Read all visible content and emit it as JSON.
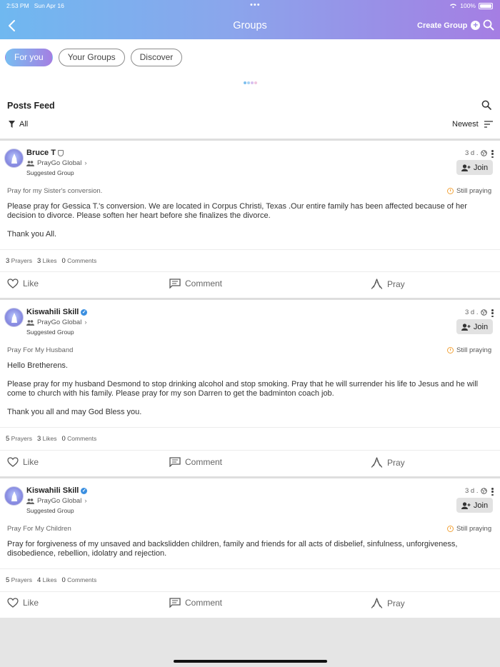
{
  "status_bar": {
    "time": "2:53 PM",
    "date": "Sun Apr 16",
    "battery": "100%"
  },
  "header": {
    "title": "Groups",
    "create_group_label": "Create Group"
  },
  "tabs": [
    {
      "label": "For you",
      "active": true
    },
    {
      "label": "Your Groups",
      "active": false
    },
    {
      "label": "Discover",
      "active": false
    }
  ],
  "feed": {
    "title": "Posts Feed",
    "filter_label": "All",
    "sort_label": "Newest"
  },
  "posts": [
    {
      "author": "Bruce T",
      "badge": "shield-icon",
      "group": "PrayGo Global",
      "suggested": "Suggested Group",
      "time": "3 d .",
      "join_label": "Join",
      "prayer_title": "Pray for my Sister's conversion.",
      "status": "Still praying",
      "body": [
        "Please pray for Gessica T.'s conversion. We are located in Corpus Christi, Texas .Our entire family has been affected because of her decision to divorce. Please soften her heart before she finalizes the divorce.",
        "Thank you All."
      ],
      "prayers_count": "3",
      "prayers_label": "Prayers",
      "likes_count": "3",
      "likes_label": "Likes",
      "comments_count": "0",
      "comments_label": "Comments",
      "like_label": "Like",
      "comment_label": "Comment",
      "pray_label": "Pray"
    },
    {
      "author": "Kiswahili Skill",
      "badge": "verified-icon",
      "group": "PrayGo Global",
      "suggested": "Suggested Group",
      "time": "3 d .",
      "join_label": "Join",
      "prayer_title": "Pray For My Husband",
      "status": "Still praying",
      "body": [
        "Hello Bretherens.",
        "Please pray for my husband Desmond to stop drinking alcohol and stop smoking. Pray that he will surrender his life to Jesus and he will come to church with his family. Please pray for my son Darren to get the badminton coach job.",
        "Thank you all and may God Bless you."
      ],
      "prayers_count": "5",
      "prayers_label": "Prayers",
      "likes_count": "3",
      "likes_label": "Likes",
      "comments_count": "0",
      "comments_label": "Comments",
      "like_label": "Like",
      "comment_label": "Comment",
      "pray_label": "Pray"
    },
    {
      "author": "Kiswahili Skill",
      "badge": "verified-icon",
      "group": "PrayGo Global",
      "suggested": "Suggested Group",
      "time": "3 d .",
      "join_label": "Join",
      "prayer_title": "Pray For My Children",
      "status": "Still praying",
      "body": [
        "Pray for forgiveness of my unsaved and backslidden children, family and friends for all acts of disbelief, sinfulness, unforgiveness, disobedience, rebellion, idolatry and rejection."
      ],
      "prayers_count": "5",
      "prayers_label": "Prayers",
      "likes_count": "4",
      "likes_label": "Likes",
      "comments_count": "0",
      "comments_label": "Comments",
      "like_label": "Like",
      "comment_label": "Comment",
      "pray_label": "Pray"
    }
  ],
  "colors": {
    "accent_start": "#6fb8f0",
    "accent_end": "#a57ee3",
    "verified": "#3a8fe0",
    "praying": "#f2a33a"
  }
}
